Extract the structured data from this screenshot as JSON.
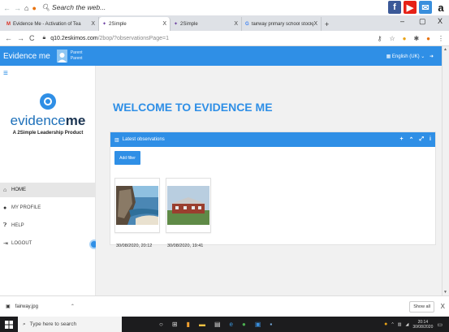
{
  "extbar": {
    "search_text": "Search the web..."
  },
  "tabs": [
    {
      "label": "Evidence Me - Activation of Tea",
      "close": "X"
    },
    {
      "label": "2Simple",
      "close": "X"
    },
    {
      "label": "2Simple",
      "close": "X"
    },
    {
      "label": "fairway primary school stockport",
      "close": "X"
    }
  ],
  "new_tab": "+",
  "window_controls": {
    "minimize": "–",
    "maximize": "▢",
    "close": "X"
  },
  "address": {
    "url_host": "q10.2eskimos.com",
    "url_path": "/2bop/?observationsPage=1"
  },
  "app": {
    "brand": "Evidence me",
    "role_line1": "Parent",
    "role_line2": "Parent",
    "language": "English (UK)"
  },
  "sidebar": {
    "logo_text_a": "evidence",
    "logo_text_b": "me",
    "tagline": "A 2Simple Leadership Product",
    "items": [
      {
        "label": "HOME",
        "icon": "home-icon"
      },
      {
        "label": "MY PROFILE",
        "icon": "user-icon"
      },
      {
        "label": "HELP",
        "icon": "help-icon"
      },
      {
        "label": "LOGOUT",
        "icon": "logout-icon"
      }
    ]
  },
  "main": {
    "welcome": "WELCOME TO EVIDENCE ME",
    "panel_title": "Latest observations",
    "add_filter": "Add filter",
    "observations": [
      {
        "caption": "30/08/2020, 20:12"
      },
      {
        "caption": "30/08/2020, 19:41"
      }
    ]
  },
  "download": {
    "file": "fairway.jpg",
    "show_all": "Show all",
    "close": "X"
  },
  "taskbar": {
    "search_placeholder": "Type here to search",
    "time": "20:14",
    "date": "30/08/2020"
  },
  "colors": {
    "accent": "#2f8fe6",
    "brand_dark": "#1c3552"
  }
}
